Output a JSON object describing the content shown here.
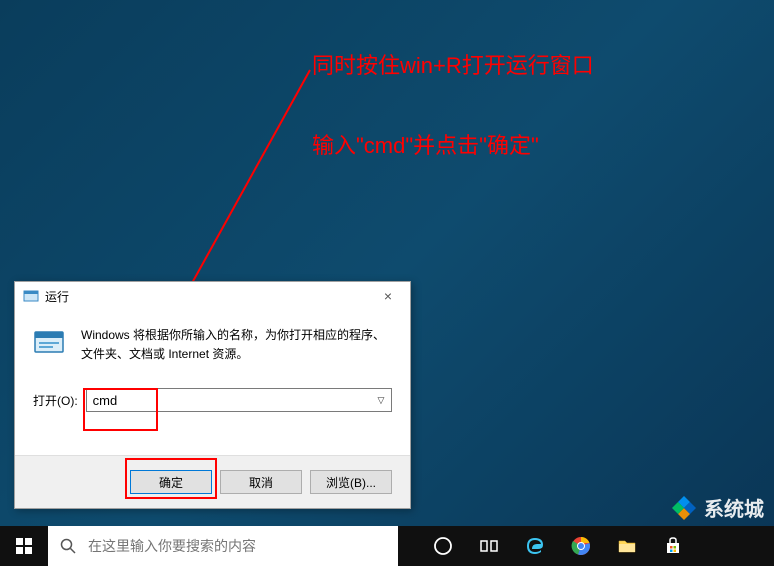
{
  "annotations": {
    "line1": "同时按住win+R打开运行窗口",
    "line2": "输入\"cmd\"并点击\"确定\""
  },
  "run_dialog": {
    "title": "运行",
    "description": "Windows 将根据你所输入的名称，为你打开相应的程序、文件夹、文档或 Internet 资源。",
    "open_label": "打开(O):",
    "input_value": "cmd",
    "buttons": {
      "ok": "确定",
      "cancel": "取消",
      "browse": "浏览(B)..."
    },
    "close_icon": "×"
  },
  "taskbar": {
    "search_placeholder": "在这里输入你要搜索的内容"
  },
  "watermark": {
    "text": "系统城"
  }
}
